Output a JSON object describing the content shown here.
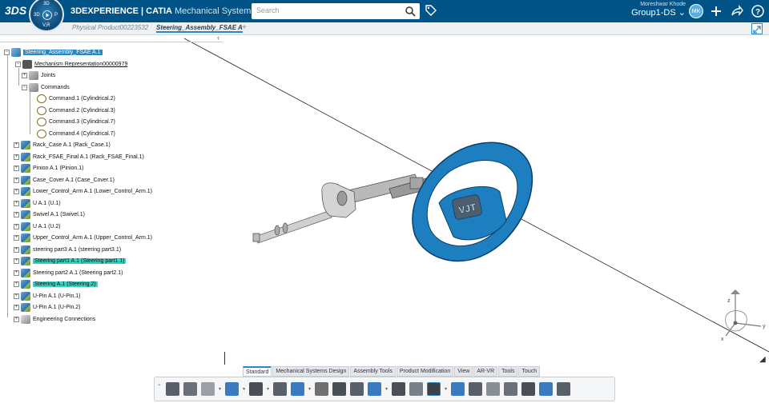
{
  "app": {
    "ds_logo": "3DS",
    "brand_bold": "3DEXPERIENCE | CATIA",
    "brand_sub": "Mechanical Systems Design",
    "compass": {
      "top": "3D",
      "left": "3D",
      "right": "P",
      "bottom": "V,R"
    }
  },
  "search": {
    "placeholder": "Search"
  },
  "user": {
    "name": "Moreshwar Khode",
    "group": "Group1-DS ⌄",
    "initials": "MK"
  },
  "tabs": [
    {
      "label": "Physical Product00223532",
      "active": false
    },
    {
      "label": "Steering_Assembly_FSAE A",
      "active": true
    }
  ],
  "tree": {
    "collapse_glyph": "‹",
    "nodes": [
      {
        "label": "Steering_Assembly_FSAE A.1",
        "style": "sel"
      },
      {
        "label": "Mechanism Representation00000979",
        "style": "ul"
      },
      {
        "label": "Joints",
        "style": ""
      },
      {
        "label": "Commands",
        "style": ""
      },
      {
        "label": "Command.1 (Cylindrical.2)",
        "style": ""
      },
      {
        "label": "Command.2 (Cylindrical.3)",
        "style": ""
      },
      {
        "label": "Command.3 (Cylindrical.7)",
        "style": ""
      },
      {
        "label": "Command.4 (Cylindrical.7)",
        "style": ""
      },
      {
        "label": "Rack_Case A.1 (Rack_Case.1)",
        "style": ""
      },
      {
        "label": "Rack_FSAE_Final A.1 (Rack_FSAE_Final.1)",
        "style": ""
      },
      {
        "label": "Pinion A.1 (Pinion.1)",
        "style": ""
      },
      {
        "label": "Case_Cover A.1 (Case_Cover.1)",
        "style": ""
      },
      {
        "label": "Lower_Control_Arm A.1 (Lower_Control_Arm.1)",
        "style": ""
      },
      {
        "label": "U A.1 (U.1)",
        "style": ""
      },
      {
        "label": "Swivel A.1 (Swivel.1)",
        "style": ""
      },
      {
        "label": "U A.1 (U.2)",
        "style": ""
      },
      {
        "label": "Upper_Control_Arm A.1 (Upper_Control_Arm.1)",
        "style": ""
      },
      {
        "label": "steering part3 A.1 (steering part3.1)",
        "style": ""
      },
      {
        "label": "Steering part1 A.1 (Steering part1.1)",
        "style": "hl"
      },
      {
        "label": "Steering part2 A.1 (Steering part2.1)",
        "style": ""
      },
      {
        "label": "Steering A.1 (Steering.2)",
        "style": "hl"
      },
      {
        "label": "U-Pin A.1 (U-Pin.1)",
        "style": ""
      },
      {
        "label": "U-Pin A.1 (U-Pin.2)",
        "style": ""
      },
      {
        "label": "Engineering Connections",
        "style": ""
      }
    ]
  },
  "model": {
    "wheel_badge": "VJT"
  },
  "triad": {
    "z": "z",
    "x": "x",
    "y": "y"
  },
  "toolbar_tabs": [
    "Standard",
    "Mechanical Systems Design",
    "Assembly Tools",
    "Product Modification",
    "View",
    "AR-VR",
    "Tools",
    "Touch"
  ],
  "action_bar": {
    "toggle_glyph": "⌄",
    "icons": [
      "cut-icon",
      "copy-icon",
      "paste-icon",
      "undo-icon",
      "select-icon",
      "mechanism-icon",
      "assembly-icon",
      "explode-icon",
      "joint-icon",
      "snap-icon",
      "constraint-icon",
      "pattern-icon",
      "command-icon",
      "simulation-icon",
      "sensor-icon",
      "move-icon",
      "stack-icon",
      "cylinder-icon",
      "clash-icon",
      "interference-icon",
      "measure-icon",
      "balance-icon"
    ],
    "colors": {
      "accent": "#2b86c4",
      "icon_dark": "#4a4f55",
      "icon_blue": "#3a7bbf"
    }
  },
  "colors": {
    "topbar": "#005386",
    "selection": "#2b86c4",
    "highlight": "#35d3c4",
    "wheel": "#1e7fc0"
  }
}
